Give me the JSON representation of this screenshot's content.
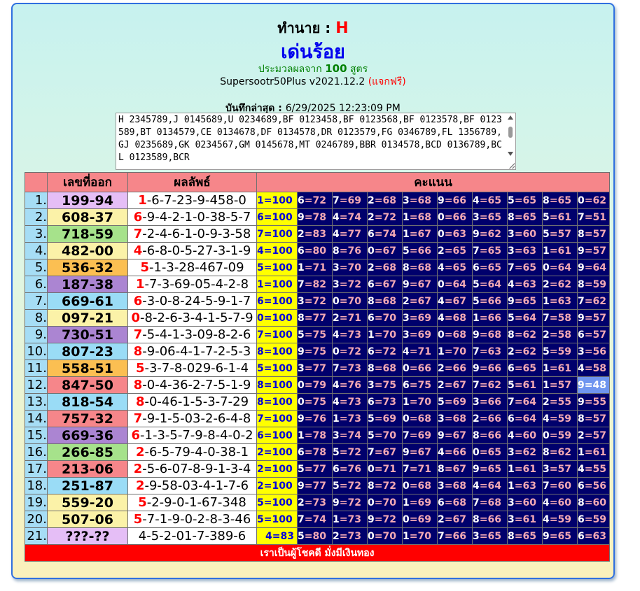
{
  "header": {
    "predict_label": "ทำนาย : ",
    "predict_value": "H",
    "title": "เด่นร้อย",
    "subtitle_pre": "ประมวลผลจาก ",
    "subtitle_num": "100",
    "subtitle_post": " สูตร",
    "version": "Supersootr50Plus v2021.12.2 ",
    "free": "(แจกฟรี)",
    "saved_label": "บันทึกล่าสุด : ",
    "saved_value": "6/29/2025 12:23:09 PM"
  },
  "textarea_value": "H 2345789,J 0145689,U 0234689,BF 0123458,BF 0123568,BF 0123578,BF 0123589,BT 0134579,CE 0134678,DF 0134578,DR 0123579,FG 0346789,FL 1356789,GJ 0235689,GK 0234567,GM 0145678,MT 0246789,BBR 0134578,BCD 0136789,BCL 0123589,BCR",
  "table": {
    "headers": [
      "เลขที่ออก",
      "ผลลัพธ์",
      "คะแนน"
    ],
    "rows": [
      {
        "idx": "1.",
        "num": "199-94",
        "color": "#e5bef6",
        "res_first": "1",
        "res_rest": "-6-7-23-9-458-0",
        "scores": [
          "1=100",
          "6=72",
          "7=69",
          "2=68",
          "3=68",
          "9=66",
          "4=65",
          "5=65",
          "8=65",
          "0=62"
        ]
      },
      {
        "idx": "2.",
        "num": "608-37",
        "color": "#fbf2a8",
        "res_first": "6",
        "res_rest": "-9-4-2-1-0-38-5-7",
        "scores": [
          "6=100",
          "9=78",
          "4=74",
          "2=72",
          "1=68",
          "0=66",
          "3=65",
          "8=65",
          "5=61",
          "7=51"
        ]
      },
      {
        "idx": "3.",
        "num": "718-59",
        "color": "#a6e28b",
        "res_first": "7",
        "res_rest": "-2-4-6-1-0-9-3-58",
        "scores": [
          "7=100",
          "2=83",
          "4=77",
          "6=74",
          "1=67",
          "0=63",
          "9=62",
          "3=60",
          "5=57",
          "8=57"
        ]
      },
      {
        "idx": "4.",
        "num": "482-00",
        "color": "#fbf2a8",
        "res_first": "4",
        "res_rest": "-6-8-0-5-27-3-1-9",
        "scores": [
          "4=100",
          "6=80",
          "8=76",
          "0=67",
          "5=66",
          "2=65",
          "7=65",
          "3=63",
          "1=61",
          "9=57"
        ]
      },
      {
        "idx": "5.",
        "num": "536-32",
        "color": "#fbbf52",
        "res_first": "5",
        "res_rest": "-1-3-28-467-09",
        "scores": [
          "5=100",
          "1=71",
          "3=70",
          "2=68",
          "8=68",
          "4=65",
          "6=65",
          "7=65",
          "0=64",
          "9=64"
        ]
      },
      {
        "idx": "6.",
        "num": "187-38",
        "color": "#ab85d2",
        "res_first": "1",
        "res_rest": "-7-3-69-05-4-2-8",
        "scores": [
          "1=100",
          "7=82",
          "3=72",
          "6=67",
          "9=67",
          "0=64",
          "5=64",
          "4=63",
          "2=62",
          "8=59"
        ]
      },
      {
        "idx": "7.",
        "num": "669-61",
        "color": "#9adcf6",
        "res_first": "6",
        "res_rest": "-3-0-8-24-5-9-1-7",
        "scores": [
          "6=100",
          "3=72",
          "0=70",
          "8=68",
          "2=67",
          "4=67",
          "5=66",
          "9=65",
          "1=63",
          "7=62"
        ]
      },
      {
        "idx": "8.",
        "num": "097-21",
        "color": "#fbf2a8",
        "res_first": "0",
        "res_rest": "-8-2-6-3-4-1-5-7-9",
        "scores": [
          "0=100",
          "8=77",
          "2=71",
          "6=70",
          "3=69",
          "4=68",
          "1=66",
          "5=64",
          "7=58",
          "9=57"
        ]
      },
      {
        "idx": "9.",
        "num": "730-51",
        "color": "#ab85d2",
        "res_first": "7",
        "res_rest": "-5-4-1-3-09-8-2-6",
        "scores": [
          "7=100",
          "5=75",
          "4=73",
          "1=70",
          "3=69",
          "0=68",
          "9=68",
          "8=62",
          "2=58",
          "6=57"
        ]
      },
      {
        "idx": "10.",
        "num": "807-23",
        "color": "#9adcf6",
        "res_first": "8",
        "res_rest": "-9-06-4-1-7-2-5-3",
        "scores": [
          "8=100",
          "9=75",
          "0=72",
          "6=72",
          "4=71",
          "1=70",
          "7=63",
          "2=62",
          "5=59",
          "3=56"
        ]
      },
      {
        "idx": "11.",
        "num": "558-51",
        "color": "#fbbf52",
        "res_first": "5",
        "res_rest": "-3-7-8-029-6-1-4",
        "scores": [
          "5=100",
          "3=77",
          "7=73",
          "8=68",
          "0=66",
          "2=66",
          "9=66",
          "6=65",
          "1=61",
          "4=58"
        ]
      },
      {
        "idx": "12.",
        "num": "847-50",
        "color": "#f6868a",
        "res_first": "8",
        "res_rest": "-0-4-36-2-7-5-1-9",
        "scores": [
          "8=100",
          "0=79",
          "4=76",
          "3=75",
          "6=75",
          "2=67",
          "7=62",
          "5=61",
          "1=57",
          "9=48"
        ]
      },
      {
        "idx": "13.",
        "num": "818-54",
        "color": "#9adcf6",
        "res_first": "8",
        "res_rest": "-0-46-1-5-3-7-29",
        "scores": [
          "8=100",
          "0=75",
          "4=73",
          "6=73",
          "1=70",
          "5=69",
          "3=66",
          "7=64",
          "2=55",
          "9=55"
        ]
      },
      {
        "idx": "14.",
        "num": "757-32",
        "color": "#f6868a",
        "res_first": "7",
        "res_rest": "-9-1-5-03-2-6-4-8",
        "scores": [
          "7=100",
          "9=76",
          "1=73",
          "5=69",
          "0=68",
          "3=68",
          "2=66",
          "6=64",
          "4=59",
          "8=57"
        ]
      },
      {
        "idx": "15.",
        "num": "669-36",
        "color": "#ab85d2",
        "res_first": "6",
        "res_rest": "-1-3-5-7-9-8-4-0-2",
        "scores": [
          "6=100",
          "1=78",
          "3=74",
          "5=70",
          "7=69",
          "9=67",
          "8=66",
          "4=60",
          "0=59",
          "2=57"
        ]
      },
      {
        "idx": "16.",
        "num": "266-85",
        "color": "#a6e28b",
        "res_first": "2",
        "res_rest": "-6-5-79-4-0-38-1",
        "scores": [
          "2=100",
          "6=78",
          "5=72",
          "7=67",
          "9=67",
          "4=66",
          "0=65",
          "3=62",
          "8=62",
          "1=61"
        ]
      },
      {
        "idx": "17.",
        "num": "213-06",
        "color": "#f6868a",
        "res_first": "2",
        "res_rest": "-5-6-07-8-9-1-3-4",
        "scores": [
          "2=100",
          "5=77",
          "6=76",
          "0=71",
          "7=71",
          "8=67",
          "9=65",
          "1=61",
          "3=57",
          "4=55"
        ]
      },
      {
        "idx": "18.",
        "num": "251-87",
        "color": "#9adcf6",
        "res_first": "2",
        "res_rest": "-9-58-03-4-1-7-6",
        "scores": [
          "2=100",
          "9=77",
          "5=72",
          "8=72",
          "0=68",
          "3=68",
          "4=64",
          "1=63",
          "7=60",
          "6=56"
        ]
      },
      {
        "idx": "19.",
        "num": "559-20",
        "color": "#fbf2a8",
        "res_first": "5",
        "res_rest": "-2-9-0-1-67-348",
        "scores": [
          "5=100",
          "2=73",
          "9=72",
          "0=70",
          "1=69",
          "6=68",
          "7=68",
          "3=60",
          "4=60",
          "8=60"
        ]
      },
      {
        "idx": "20.",
        "num": "507-06",
        "color": "#fbf2a8",
        "res_first": "5",
        "res_rest": "-7-1-9-0-2-8-3-46",
        "scores": [
          "5=100",
          "7=74",
          "1=73",
          "9=72",
          "0=69",
          "2=67",
          "8=66",
          "3=61",
          "4=59",
          "6=59"
        ]
      },
      {
        "idx": "21.",
        "num": "???-??",
        "color": "#e5bef6",
        "res_first": "",
        "res_rest": "4-5-2-01-7-389-6",
        "scores": [
          "4=83",
          "5=80",
          "2=73",
          "0=70",
          "1=70",
          "7=66",
          "3=65",
          "8=65",
          "9=65",
          "6=63"
        ]
      }
    ],
    "highlight": {
      "row": 11,
      "col": 9
    },
    "footer": "เราเป็นผู้โชคดี มั่งมีเงินทอง"
  }
}
